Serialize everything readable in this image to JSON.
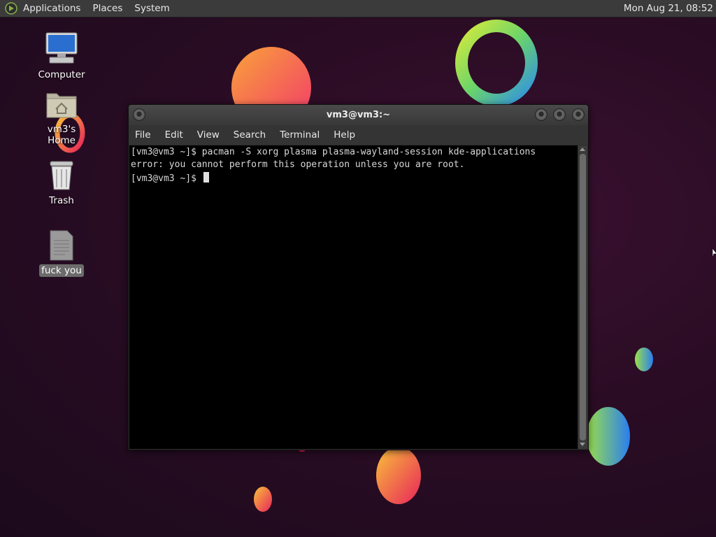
{
  "panel": {
    "menus": [
      "Applications",
      "Places",
      "System"
    ],
    "clock": "Mon Aug 21, 08:52"
  },
  "desktop": {
    "icons": [
      {
        "label": "Computer",
        "icon": "computer-icon"
      },
      {
        "label": "vm3's Home",
        "icon": "home-folder-icon"
      },
      {
        "label": "Trash",
        "icon": "trash-icon"
      },
      {
        "label": "fuck you",
        "icon": "text-file-icon"
      }
    ]
  },
  "terminal": {
    "title": "vm3@vm3:~",
    "menu": [
      "File",
      "Edit",
      "View",
      "Search",
      "Terminal",
      "Help"
    ],
    "lines": [
      "[vm3@vm3 ~]$ pacman -S xorg plasma plasma-wayland-session kde-applications",
      "error: you cannot perform this operation unless you are root.",
      "[vm3@vm3 ~]$ "
    ]
  }
}
